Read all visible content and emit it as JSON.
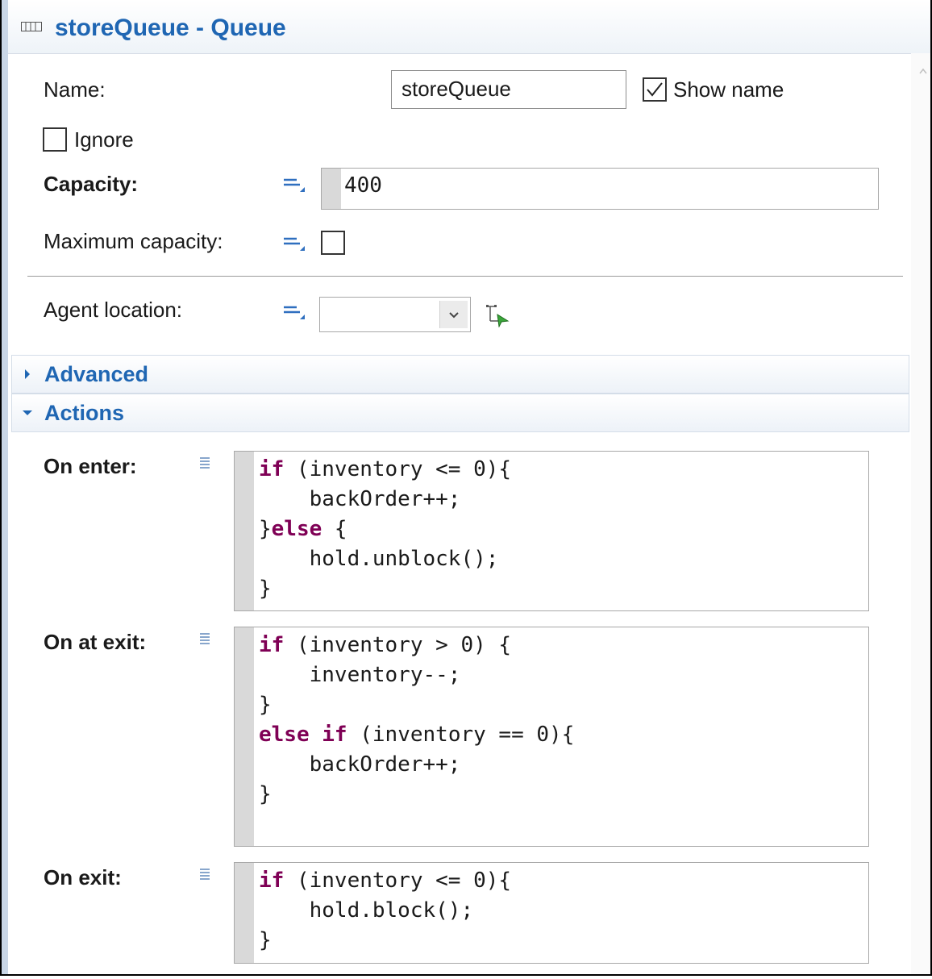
{
  "panel": {
    "title": "storeQueue - Queue",
    "title_icon": "queue-icon",
    "accent_color": "#1f66b3"
  },
  "fields": {
    "name_label": "Name:",
    "name_value": "storeQueue",
    "show_name_label": "Show name",
    "show_name_checked": true,
    "ignore_label": "Ignore",
    "ignore_checked": false,
    "capacity_label": "Capacity:",
    "capacity_value": "400",
    "max_capacity_label": "Maximum capacity:",
    "max_capacity_checked": false,
    "agent_location_label": "Agent location:",
    "agent_location_value": ""
  },
  "sections": {
    "advanced": {
      "label": "Advanced",
      "expanded": false
    },
    "actions": {
      "label": "Actions",
      "expanded": true
    }
  },
  "actions": {
    "on_enter": {
      "label": "On enter:",
      "code": [
        [
          {
            "t": "if",
            "k": true
          },
          {
            "t": " (inventory <= 0){"
          }
        ],
        [
          {
            "t": "    backOrder++;"
          }
        ],
        [
          {
            "t": "}"
          },
          {
            "t": "else",
            "k": true
          },
          {
            "t": " {"
          }
        ],
        [
          {
            "t": "    hold.unblock();"
          }
        ],
        [
          {
            "t": "}"
          }
        ]
      ]
    },
    "on_at_exit": {
      "label": "On at exit:",
      "code": [
        [
          {
            "t": "if",
            "k": true
          },
          {
            "t": " (inventory > 0) {"
          }
        ],
        [
          {
            "t": "    inventory--;"
          }
        ],
        [
          {
            "t": "}"
          }
        ],
        [
          {
            "t": "else",
            "k": true
          },
          {
            "t": " "
          },
          {
            "t": "if",
            "k": true
          },
          {
            "t": " (inventory == 0){"
          }
        ],
        [
          {
            "t": "    backOrder++;"
          }
        ],
        [
          {
            "t": "}"
          }
        ]
      ]
    },
    "on_exit": {
      "label": "On exit:",
      "code": [
        [
          {
            "t": "if",
            "k": true
          },
          {
            "t": " (inventory <= 0){"
          }
        ],
        [
          {
            "t": "    hold.block();"
          }
        ],
        [
          {
            "t": "}"
          }
        ]
      ]
    }
  },
  "colors": {
    "keyword": "#7f0055"
  }
}
